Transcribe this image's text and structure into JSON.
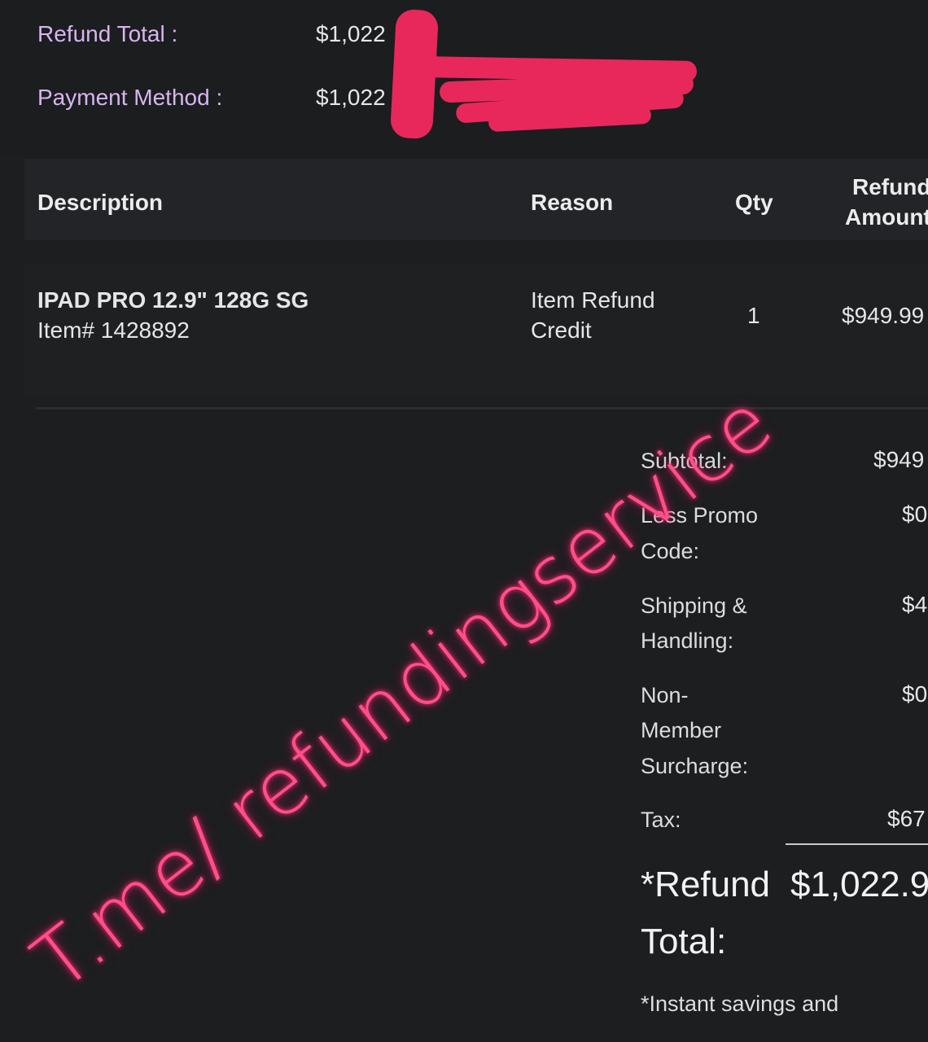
{
  "summary": {
    "refund_total_label": "Refund Total :",
    "refund_total_value": "$1,022",
    "payment_method_label": "Payment Method :",
    "payment_method_value": "$1,022"
  },
  "table": {
    "headers": {
      "description": "Description",
      "reason": "Reason",
      "qty": "Qty",
      "refund_amount_line1": "Refund",
      "refund_amount_line2": "Amount"
    },
    "rows": [
      {
        "description": "IPAD PRO 12.9\" 128G SG",
        "item_number": "Item# 1428892",
        "reason_line1": "Item Refund",
        "reason_line2": "Credit",
        "qty": "1",
        "amount": "$949.99"
      }
    ]
  },
  "totals": {
    "subtotal_label": "Subtotal:",
    "subtotal_value": "$949",
    "promo_label_1": "Less Promo",
    "promo_label_2": "Code:",
    "promo_value": "$0",
    "shipping_label_1": "Shipping &",
    "shipping_label_2": "Handling:",
    "shipping_value": "$4",
    "surcharge_label_1": "Non-",
    "surcharge_label_2": "Member",
    "surcharge_label_3": "Surcharge:",
    "surcharge_value": "$0",
    "tax_label": "Tax:",
    "tax_value": "$67",
    "refund_total_label_1": "*Refund",
    "refund_total_label_2": "Total:",
    "refund_total_value": "$1,022.9"
  },
  "footnote": "*Instant savings and",
  "watermark_text": "T.me/ refundingservice",
  "colors": {
    "background": "#1c1e20",
    "label_purple": "#d8b4f0",
    "redaction": "#e8285a",
    "watermark": "#ff4f88"
  }
}
